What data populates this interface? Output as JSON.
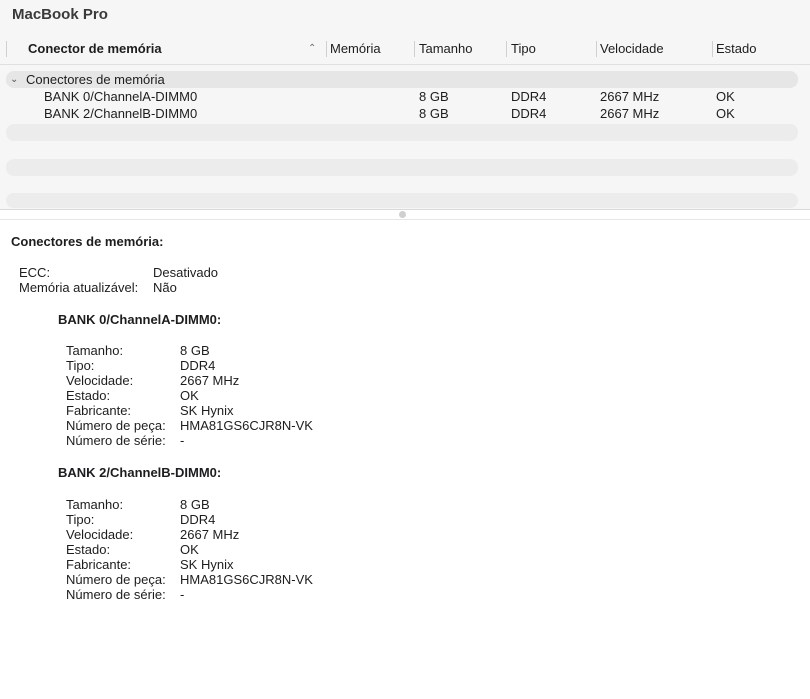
{
  "window": {
    "title": "MacBook Pro"
  },
  "table": {
    "columns": [
      "Conector de memória",
      "Memória",
      "Tamanho",
      "Tipo",
      "Velocidade",
      "Estado"
    ],
    "group_label": "Conectores de memória",
    "rows": [
      {
        "name": "BANK 0/ChannelA-DIMM0",
        "memory": "",
        "size": "8 GB",
        "type": "DDR4",
        "speed": "2667 MHz",
        "status": "OK"
      },
      {
        "name": "BANK 2/ChannelB-DIMM0",
        "memory": "",
        "size": "8 GB",
        "type": "DDR4",
        "speed": "2667 MHz",
        "status": "OK"
      }
    ]
  },
  "detail": {
    "heading": "Conectores de memória:",
    "summary": [
      {
        "label": "ECC:",
        "value": "Desativado"
      },
      {
        "label": "Memória atualizável:",
        "value": "Não"
      }
    ],
    "banks": [
      {
        "title": "BANK 0/ChannelA-DIMM0:",
        "fields": [
          {
            "label": "Tamanho:",
            "value": "8 GB"
          },
          {
            "label": "Tipo:",
            "value": "DDR4"
          },
          {
            "label": "Velocidade:",
            "value": "2667 MHz"
          },
          {
            "label": "Estado:",
            "value": "OK"
          },
          {
            "label": "Fabricante:",
            "value": "SK Hynix"
          },
          {
            "label": "Número de peça:",
            "value": "HMA81GS6CJR8N-VK"
          },
          {
            "label": "Número de série:",
            "value": "-"
          }
        ]
      },
      {
        "title": "BANK 2/ChannelB-DIMM0:",
        "fields": [
          {
            "label": "Tamanho:",
            "value": "8 GB"
          },
          {
            "label": "Tipo:",
            "value": "DDR4"
          },
          {
            "label": "Velocidade:",
            "value": "2667 MHz"
          },
          {
            "label": "Estado:",
            "value": "OK"
          },
          {
            "label": "Fabricante:",
            "value": "SK Hynix"
          },
          {
            "label": "Número de peça:",
            "value": "HMA81GS6CJR8N-VK"
          },
          {
            "label": "Número de série:",
            "value": "-"
          }
        ]
      }
    ]
  },
  "icons": {
    "sort": "chevron-up-icon",
    "disclosure": "chevron-down-icon",
    "splitter": "split-handle-icon"
  }
}
